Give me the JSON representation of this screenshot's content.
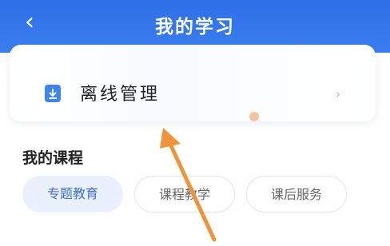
{
  "header": {
    "back_icon": "chevron-left-icon",
    "back_glyph": "‹",
    "title": "我的学习"
  },
  "offline": {
    "label": "离线管理",
    "icon": "download-icon",
    "chevron": "›"
  },
  "courses": {
    "title": "我的课程",
    "tabs": [
      {
        "label": "专题教育",
        "active": true
      },
      {
        "label": "课程教学",
        "active": false
      },
      {
        "label": "课后服务",
        "active": false
      }
    ]
  },
  "colors": {
    "header": "#2f6fe6",
    "accent": "#3d86f0",
    "arrow": "#f0943a"
  }
}
